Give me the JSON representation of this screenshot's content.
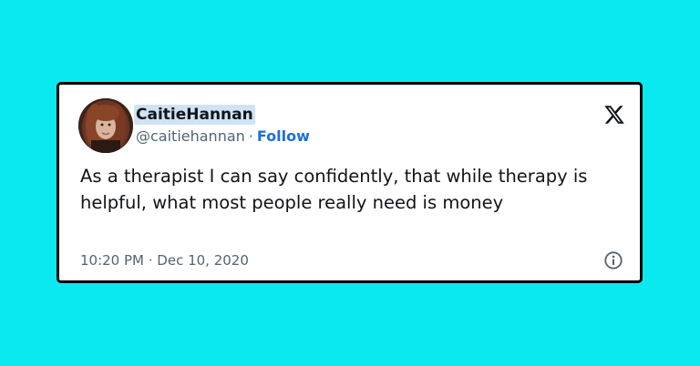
{
  "tweet": {
    "display_name": "CaitieHannan",
    "handle": "@caitiehannan",
    "separator": "·",
    "follow_label": "Follow",
    "text": "As a therapist I can say confidently, that while therapy is helpful, what most people really need is money",
    "timestamp": "10:20 PM · Dec 10, 2020"
  },
  "icons": {
    "logo": "x-logo-icon",
    "info": "info-icon",
    "avatar": "avatar-photo"
  },
  "colors": {
    "background": "#0ae9f0",
    "card": "#ffffff",
    "card_border": "#000000",
    "text": "#0f1419",
    "muted": "#536471",
    "follow": "#1d6fd6",
    "name_highlight": "#cfe3f4"
  }
}
